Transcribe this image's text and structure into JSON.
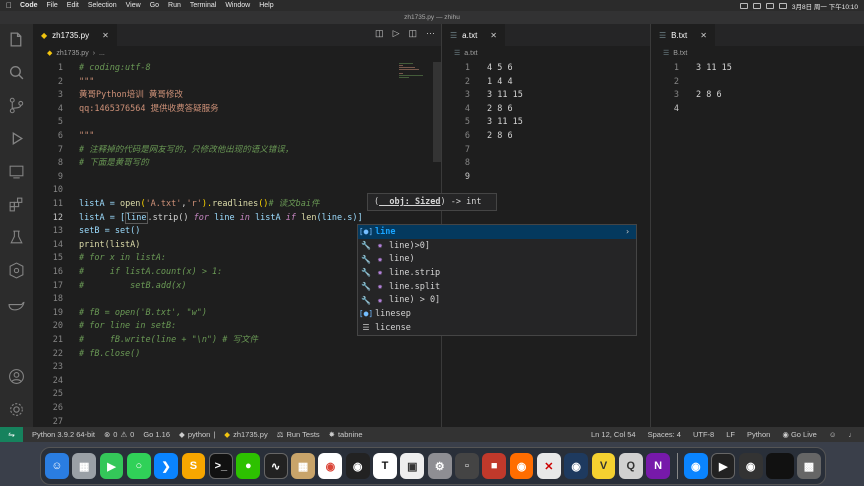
{
  "menubar": {
    "items": [
      "Code",
      "File",
      "Edit",
      "Selection",
      "View",
      "Go",
      "Run",
      "Terminal",
      "Window",
      "Help"
    ],
    "clock": "3月8日 周一 下午10:10"
  },
  "window": {
    "title": "zh1735.py — zhihu"
  },
  "editor1": {
    "tab": "zh1735.py",
    "breadcrumb_file": "zh1735.py",
    "breadcrumb_more": "...",
    "line_numbers": [
      "1",
      "2",
      "3",
      "4",
      "5",
      "6",
      "7",
      "8",
      "9",
      "10",
      "11",
      "12",
      "13",
      "14",
      "15",
      "16",
      "17",
      "18",
      "19",
      "20",
      "21",
      "22",
      "23",
      "24",
      "25",
      "26",
      "27"
    ],
    "lines": {
      "l1": "# coding:utf-8",
      "l2": "\"\"\"",
      "l3": "黄哥Python培训 黄哥修改",
      "l4": "qq:1465376564 提供收费答疑服务",
      "l6": "\"\"\"",
      "l7": "# 注释掉的代码是网友写的，只修改他出现的语义错误，",
      "l8": "# 下面是黄哥写的",
      "l11_a": "listA = ",
      "l11_b": "open",
      "l11_c": "(",
      "l11_d": "'A.txt'",
      "l11_e": ",",
      "l11_f": "'r'",
      "l11_g": ").",
      "l11_h": "readlines",
      "l11_i": "()",
      "l11_j": "# 读文bai件",
      "l12_a": "listA = [",
      "l12_b": "line",
      "l12_c": ".strip() ",
      "l12_d": "for",
      "l12_e": " line ",
      "l12_f": "in",
      "l12_g": " listA ",
      "l12_h": "if",
      "l12_i": " ",
      "l12_j": "len",
      "l12_k": "(line.s)]",
      "l13": "setB = set()",
      "l14": "print(listA)",
      "l15": "# for x in listA:",
      "l16": "#     if listA.count(x) > 1:",
      "l17": "#         setB.add(x)",
      "l19": "# fB = open('B.txt', \"w\")",
      "l20": "# for line in setB:",
      "l21": "#     fB.write(line + \"\\n\") # 写文件",
      "l22": "# fB.close()"
    }
  },
  "hover": {
    "open": "(",
    "param": "__obj: Sized",
    "close": ") -> int"
  },
  "suggestions": [
    {
      "label": "line",
      "sel": true
    },
    {
      "label": "line)>0]"
    },
    {
      "label": "line)"
    },
    {
      "label": "line.strip"
    },
    {
      "label": "line.split"
    },
    {
      "label": "line) > 0]"
    },
    {
      "label": "linesep"
    },
    {
      "label": "license"
    }
  ],
  "editor2": {
    "tab": "a.txt",
    "breadcrumb": "a.txt",
    "line_numbers": [
      "1",
      "2",
      "3",
      "4",
      "5",
      "6",
      "7",
      "8",
      "9"
    ],
    "lines": [
      "4 5 6",
      "1 4 4",
      "3 11 15",
      "2 8 6",
      "3 11 15",
      "2 8 6",
      "",
      "",
      ""
    ]
  },
  "editor3": {
    "tab": "B.txt",
    "breadcrumb": "B.txt",
    "line_numbers": [
      "1",
      "2",
      "3",
      "4"
    ],
    "lines": [
      "3 11 15",
      "",
      "2 8 6",
      ""
    ]
  },
  "statusbar": {
    "python": "Python 3.9.2 64-bit",
    "errors": "0",
    "warnings": "0",
    "go": "Go 1.16",
    "python_lang": "python",
    "file": "zh1735.py",
    "tests": "Run Tests",
    "tabnine": "tabnine",
    "position": "Ln 12, Col 54",
    "spaces": "Spaces: 4",
    "encoding": "UTF-8",
    "eol": "LF",
    "language": "Python",
    "golive": "Go Live"
  },
  "colors": {
    "accent": "#16825d",
    "selection": "#04395e"
  }
}
